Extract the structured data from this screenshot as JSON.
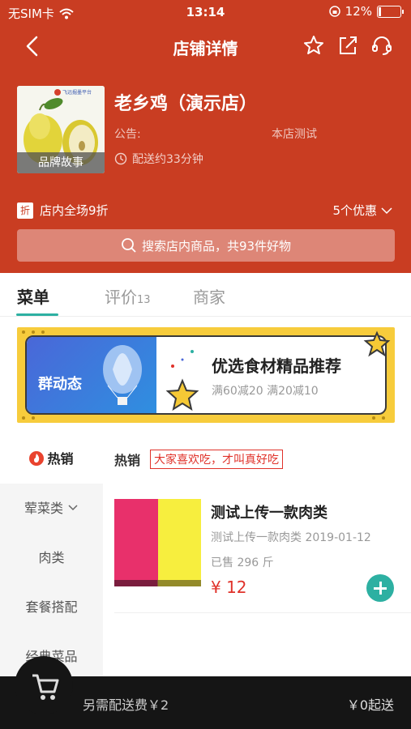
{
  "status_bar": {
    "carrier": "无SIM卡",
    "time": "13:14",
    "battery": "12%",
    "battery_level": 0.12
  },
  "nav": {
    "title": "店铺详情",
    "back_icon": "chevron-left-icon",
    "icons": [
      "star-icon",
      "share-icon",
      "headset-icon"
    ]
  },
  "store": {
    "name": "老乡鸡（演示店）",
    "image_caption": "品牌故事",
    "logo_text": "飞远掘墨平台",
    "notice_label": "公告:",
    "notice_text": "本店测试",
    "delivery": "配送约33分钟"
  },
  "promo": {
    "badge": "折",
    "text": "店内全场9折",
    "count": "5个优惠"
  },
  "search": {
    "placeholder": "搜索店内商品，共93件好物"
  },
  "tabs": [
    {
      "label": "菜单",
      "count": ""
    },
    {
      "label": "评价",
      "count": "13"
    },
    {
      "label": "商家",
      "count": ""
    }
  ],
  "banner": {
    "brand": "群动态",
    "title": "优选食材精品推荐",
    "subtitle": "满60减20 满20减10"
  },
  "sidebar": {
    "items": [
      {
        "label": "热销"
      },
      {
        "label": "荤菜类"
      },
      {
        "label": "肉类"
      },
      {
        "label": "套餐搭配"
      },
      {
        "label": "经典菜品"
      }
    ]
  },
  "category": {
    "title": "热销",
    "slogan": "大家喜欢吃，才叫真好吃"
  },
  "product": {
    "name": "测试上传一款肉类",
    "desc": "测试上传一款肉类 2019-01-12",
    "sold": "已售 296 斤",
    "price": "¥ 12"
  },
  "cart": {
    "fee": "另需配送费￥2",
    "min_order": "￥0起送"
  },
  "colors": {
    "brand_red": "#c93d22",
    "accent_teal": "#2db0a2",
    "price_red": "#e0322a"
  }
}
